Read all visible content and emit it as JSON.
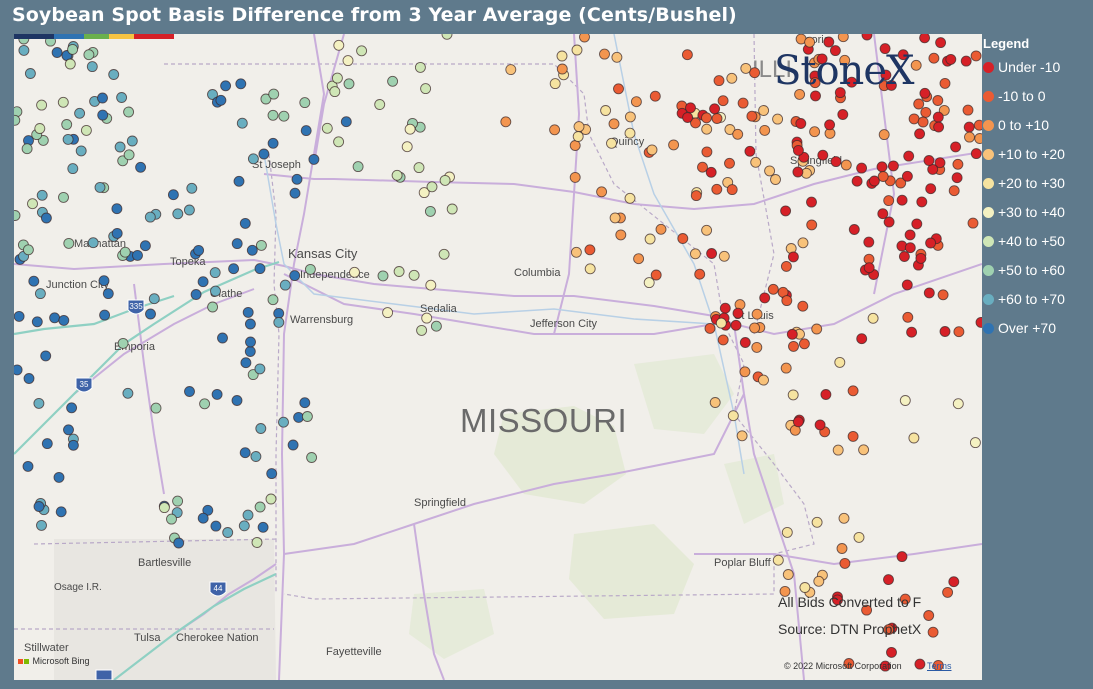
{
  "title": "Soybean Spot Basis Difference from 3 Year Average (Cents/Bushel)",
  "legend": {
    "title": "Legend",
    "items": [
      {
        "label": "Under -10",
        "color": "#d62027"
      },
      {
        "label": "-10 to 0",
        "color": "#ea5b33"
      },
      {
        "label": "0 to +10",
        "color": "#f3954f"
      },
      {
        "label": "+10 to +20",
        "color": "#f8c27a"
      },
      {
        "label": "+20 to +30",
        "color": "#f6e3a0"
      },
      {
        "label": "+30 to +40",
        "color": "#f4f1c2"
      },
      {
        "label": "+40 to +50",
        "color": "#cfe6b6"
      },
      {
        "label": "+50 to +60",
        "color": "#9fd1b0"
      },
      {
        "label": "+60 to +70",
        "color": "#69aec0"
      },
      {
        "label": "Over +70",
        "color": "#2f73b2"
      }
    ]
  },
  "map": {
    "state_label": "MISSOURI",
    "faint_label": "ILLI",
    "places": [
      "St Joseph",
      "Manhattan",
      "Topeka",
      "Kansas City",
      "Independence",
      "Junction City",
      "Olathe",
      "Warrensburg",
      "Sedalia",
      "Columbia",
      "Jefferson City",
      "Emporia",
      "Quincy",
      "Springfield",
      "St Louis",
      "Springfield",
      "Bartlesville",
      "Osage I.R.",
      "Poplar Bluff",
      "Tulsa",
      "Cherokee Nation",
      "Stillwater",
      "Fayetteville",
      "Peoria"
    ],
    "shields": [
      "35",
      "335",
      "44"
    ]
  },
  "logo": "StoneX",
  "notes": {
    "line1": "All Bids Converted to F",
    "line2": "Source: DTN ProphetX"
  },
  "attribution": {
    "bing": "Microsoft Bing",
    "copyright": "© 2022 Microsoft Corporation",
    "terms": "Terms"
  }
}
